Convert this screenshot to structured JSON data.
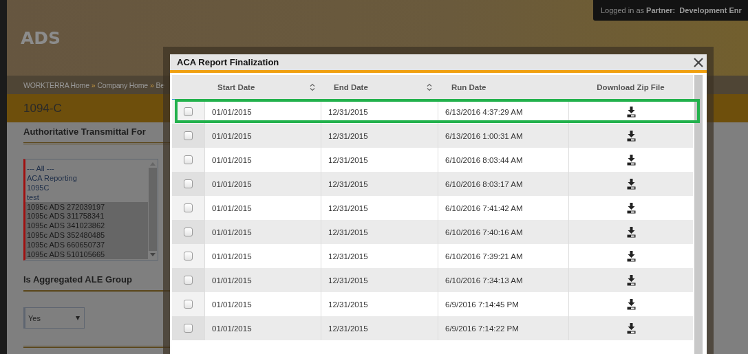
{
  "header": {
    "logo": "ADS",
    "login": "Logged in as **Partner:  Development Enr**"
  },
  "breadcrumb": [
    {
      "kind": "link",
      "label": "WORKTERRA Home"
    },
    {
      "kind": "sep",
      "label": "»"
    },
    {
      "kind": "link",
      "label": "Company Home"
    },
    {
      "kind": "sep",
      "label": "»"
    },
    {
      "kind": "link",
      "label": "Be"
    }
  ],
  "page_title": "1094-C",
  "transmittal": {
    "label": "Authoritative Transmittal For",
    "items": [
      {
        "label": "--- All ---",
        "selected": false
      },
      {
        "label": "ACA Reporting",
        "selected": false
      },
      {
        "label": "1095C",
        "selected": false
      },
      {
        "label": "test",
        "selected": false
      },
      {
        "label": "1095c ADS 272039197",
        "selected": true
      },
      {
        "label": "1095c ADS 311758341",
        "selected": true
      },
      {
        "label": "1095c ADS 341023862",
        "selected": true
      },
      {
        "label": "1095c ADS 352480485",
        "selected": true
      },
      {
        "label": "1095c ADS 660650737",
        "selected": true
      },
      {
        "label": "1095c ADS 510105665",
        "selected": true
      }
    ]
  },
  "ale_group": {
    "label": "Is Aggregated ALE Group",
    "value": "Yes"
  },
  "modal": {
    "title": "ACA Report Finalization",
    "columns": [
      {
        "label": "Start Date",
        "sortable": true
      },
      {
        "label": "End Date",
        "sortable": true
      },
      {
        "label": "Run Date",
        "sortable": false
      },
      {
        "label": "Download Zip File",
        "sortable": false
      }
    ],
    "rows": [
      {
        "start": "01/01/2015",
        "end": "12/31/2015",
        "run": "6/13/2016 4:37:29 AM",
        "checked": false,
        "highlighted": true
      },
      {
        "start": "01/01/2015",
        "end": "12/31/2015",
        "run": "6/13/2016 1:00:31 AM",
        "checked": false,
        "highlighted": false
      },
      {
        "start": "01/01/2015",
        "end": "12/31/2015",
        "run": "6/10/2016 8:03:44 AM",
        "checked": false,
        "highlighted": false
      },
      {
        "start": "01/01/2015",
        "end": "12/31/2015",
        "run": "6/10/2016 8:03:17 AM",
        "checked": false,
        "highlighted": false
      },
      {
        "start": "01/01/2015",
        "end": "12/31/2015",
        "run": "6/10/2016 7:41:42 AM",
        "checked": false,
        "highlighted": false
      },
      {
        "start": "01/01/2015",
        "end": "12/31/2015",
        "run": "6/10/2016 7:40:16 AM",
        "checked": false,
        "highlighted": false
      },
      {
        "start": "01/01/2015",
        "end": "12/31/2015",
        "run": "6/10/2016 7:39:21 AM",
        "checked": false,
        "highlighted": false
      },
      {
        "start": "01/01/2015",
        "end": "12/31/2015",
        "run": "6/10/2016 7:34:13 AM",
        "checked": false,
        "highlighted": false
      },
      {
        "start": "01/01/2015",
        "end": "12/31/2015",
        "run": "6/9/2016 7:14:45 PM",
        "checked": false,
        "highlighted": false
      },
      {
        "start": "01/01/2015",
        "end": "12/31/2015",
        "run": "6/9/2016 7:14:22 PM",
        "checked": false,
        "highlighted": false
      }
    ]
  }
}
